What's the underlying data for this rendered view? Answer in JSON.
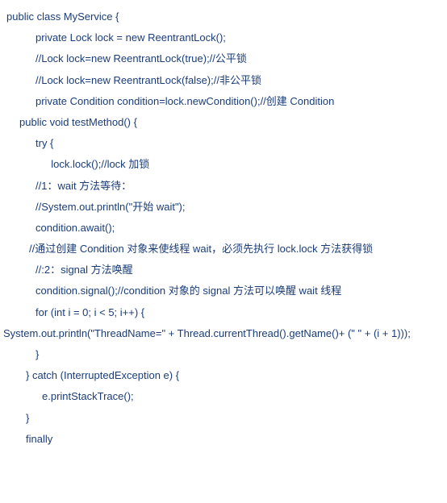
{
  "code": {
    "lines": [
      {
        "text": "public class MyService {",
        "indent": "indent-0"
      },
      {
        "text": "private Lock lock = new ReentrantLock();",
        "indent": "indent-1"
      },
      {
        "text": "//Lock lock=new ReentrantLock(true);//公平锁",
        "indent": "indent-1"
      },
      {
        "text": "//Lock lock=new ReentrantLock(false);//非公平锁",
        "indent": "indent-1"
      },
      {
        "text": "private Condition condition=lock.newCondition();//创建 Condition",
        "indent": "indent-1"
      },
      {
        "text": "public void testMethod() {",
        "indent": "indent-2"
      },
      {
        "text": "try {",
        "indent": "indent-3"
      },
      {
        "text": "  lock.lock();//lock 加锁",
        "indent": "indent-4"
      },
      {
        "text": "//1：wait 方法等待：",
        "indent": "indent-5"
      },
      {
        "text": "//System.out.println(\"开始 wait\");",
        "indent": "indent-5"
      },
      {
        "text": "condition.await();",
        "indent": "indent-5"
      },
      {
        "text": "//通过创建 Condition 对象来使线程 wait，必须先执行 lock.lock 方法获得锁",
        "indent": "indent-6"
      },
      {
        "text": "//:2：signal 方法唤醒",
        "indent": "indent-5"
      },
      {
        "text": "condition.signal();//condition 对象的 signal 方法可以唤醒 wait 线程",
        "indent": "indent-5"
      },
      {
        "text": "for (int i = 0; i < 5; i++) {",
        "indent": "indent-5"
      },
      {
        "text": "System.out.println(\"ThreadName=\" + Thread.currentThread().getName()+ (\" \" + (i + 1)));",
        "indent": "indent-7"
      },
      {
        "text": "}",
        "indent": "indent-8"
      },
      {
        "text": "} catch (InterruptedException e) {",
        "indent": "indent-9"
      },
      {
        "text": "e.printStackTrace();",
        "indent": "indent-10"
      },
      {
        "text": "}",
        "indent": "indent-11"
      },
      {
        "text": "finally",
        "indent": "indent-12"
      }
    ]
  }
}
